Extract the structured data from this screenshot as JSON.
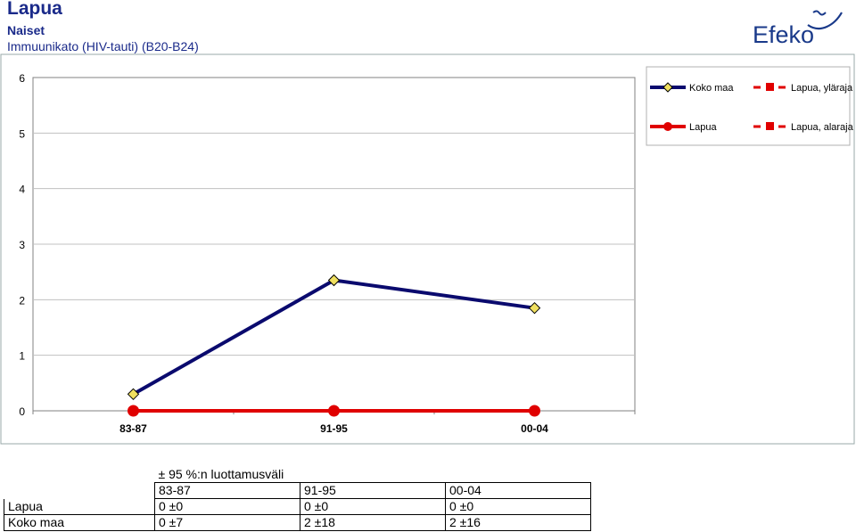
{
  "header": {
    "title": "Lapua",
    "subtitle": "Naiset",
    "description": "Immuunikato (HIV-tauti) (B20-B24)"
  },
  "logo": {
    "text": "Efeko",
    "color": "#1a3a8a"
  },
  "chart_data": {
    "type": "line",
    "categories": [
      "83-87",
      "91-95",
      "00-04"
    ],
    "ylim": [
      0,
      6
    ],
    "yticks": [
      "0",
      "1",
      "2",
      "3",
      "4",
      "5",
      "6"
    ],
    "grid": true,
    "legend_placement": "top-right",
    "series": [
      {
        "name": "Koko maa",
        "values": [
          0.3,
          2.35,
          1.85
        ],
        "color": "#0a0a6e",
        "marker": "diamond",
        "marker_fill": "#f0e060"
      },
      {
        "name": "Lapua",
        "values": [
          0,
          0,
          0
        ],
        "color": "#e00000",
        "marker": "circle",
        "marker_fill": "#e00000"
      },
      {
        "name": "Lapua, yläraja",
        "values": [],
        "color": "#e00000",
        "marker": "square",
        "dashed": true
      },
      {
        "name": "Lapua, alaraja",
        "values": [],
        "color": "#e00000",
        "marker": "square",
        "dashed": true
      }
    ]
  },
  "ci_table": {
    "caption": "± 95 %:n luottamusväli",
    "columns": [
      "83-87",
      "91-95",
      "00-04"
    ],
    "rows": [
      {
        "label": "Lapua",
        "cells": [
          "0 ±0",
          "0 ±0",
          "0 ±0"
        ]
      },
      {
        "label": "Koko maa",
        "cells": [
          "0 ±7",
          "2 ±18",
          "2 ±16"
        ]
      }
    ]
  }
}
